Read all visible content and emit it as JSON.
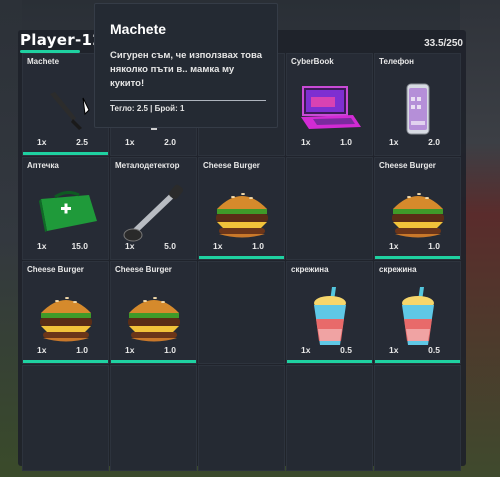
{
  "header": {
    "player_name": "Player-12",
    "weight_total": "33.5/250"
  },
  "tooltip": {
    "title": "Machete",
    "description": "Сигурен съм, че използвах това няколко пъти в.. мамка му кукито!",
    "meta": "Тегло: 2.5 | Брой: 1"
  },
  "slots": [
    {
      "name": "Machete",
      "qty": "1x",
      "weight": "2.5",
      "icon": "machete-icon"
    },
    {
      "name": "",
      "qty": "1x",
      "weight": "2.0",
      "icon": "item-icon"
    },
    {
      "name": "",
      "qty": "",
      "weight": "",
      "icon": ""
    },
    {
      "name": "CyberBook",
      "qty": "1x",
      "weight": "1.0",
      "icon": "laptop-icon"
    },
    {
      "name": "Телефон",
      "qty": "1x",
      "weight": "2.0",
      "icon": "phone-icon"
    },
    {
      "name": "Аптечка",
      "qty": "1x",
      "weight": "15.0",
      "icon": "first-aid-kit-icon"
    },
    {
      "name": "Металодетектор",
      "qty": "1x",
      "weight": "5.0",
      "icon": "metal-detector-icon"
    },
    {
      "name": "Cheese Burger",
      "qty": "1x",
      "weight": "1.0",
      "icon": "burger-icon"
    },
    {
      "name": "",
      "qty": "",
      "weight": "",
      "icon": ""
    },
    {
      "name": "Cheese Burger",
      "qty": "1x",
      "weight": "1.0",
      "icon": "burger-icon"
    },
    {
      "name": "Cheese Burger",
      "qty": "1x",
      "weight": "1.0",
      "icon": "burger-icon"
    },
    {
      "name": "Cheese Burger",
      "qty": "1x",
      "weight": "1.0",
      "icon": "burger-icon"
    },
    {
      "name": "",
      "qty": "",
      "weight": "",
      "icon": ""
    },
    {
      "name": "скрежина",
      "qty": "1x",
      "weight": "0.5",
      "icon": "smoothie-icon"
    },
    {
      "name": "скрежина",
      "qty": "1x",
      "weight": "0.5",
      "icon": "smoothie-icon"
    }
  ],
  "colors": {
    "accent": "#1fd1a1",
    "panel": "#1e222a",
    "slot": "#252a33"
  }
}
